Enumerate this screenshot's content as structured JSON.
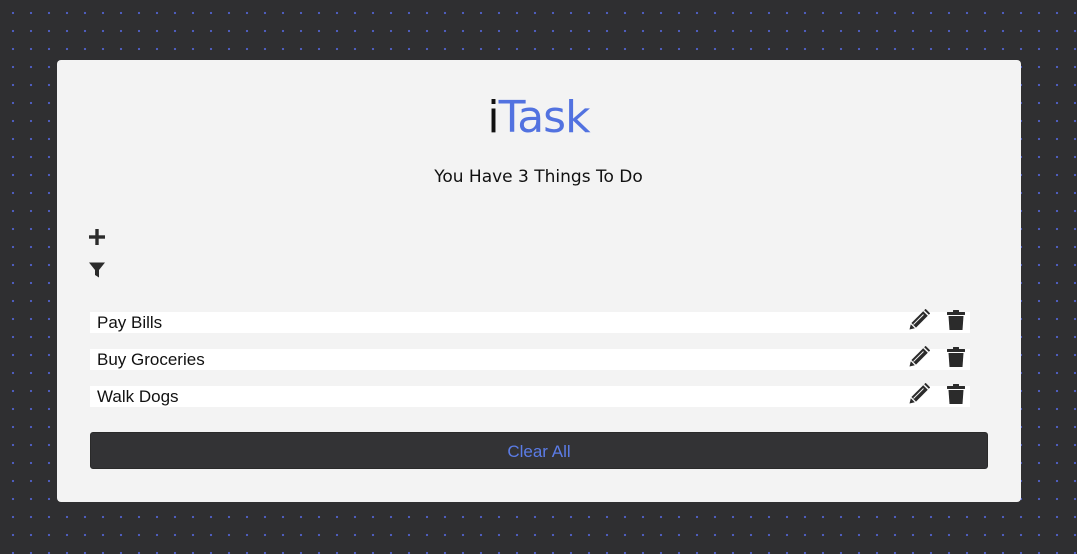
{
  "app": {
    "title_prefix": "i",
    "title_main": "Task",
    "subtitle": "You Have 3 Things To Do"
  },
  "toolbar": {
    "add_icon": "plus-icon",
    "filter_icon": "filter-icon"
  },
  "tasks": [
    {
      "label": "Pay Bills"
    },
    {
      "label": "Buy Groceries"
    },
    {
      "label": "Walk Dogs"
    }
  ],
  "task_actions": {
    "edit_icon": "pencil-icon",
    "delete_icon": "trash-icon"
  },
  "footer": {
    "clear_label": "Clear All"
  },
  "colors": {
    "background": "#2f2f31",
    "card": "#f3f3f3",
    "accent": "#5272e0",
    "button_bg": "#333335"
  }
}
